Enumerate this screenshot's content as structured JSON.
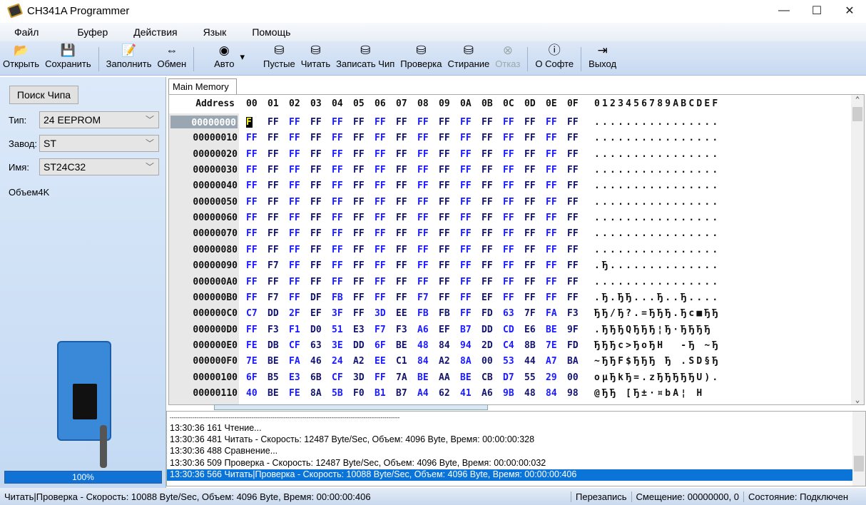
{
  "window": {
    "title": "CH341A Programmer",
    "minimize": "—",
    "maximize": "☐",
    "close": "✕"
  },
  "menu": [
    "Файл",
    "Буфер",
    "Действия",
    "Язык",
    "Помощь"
  ],
  "toolbar": [
    {
      "label": "Открыть",
      "icon": "📂"
    },
    {
      "label": "Сохранить",
      "icon": "💾"
    },
    {
      "sep": true
    },
    {
      "label": "Заполнить",
      "icon": "📝"
    },
    {
      "label": "Обмен",
      "icon": "⇔"
    },
    {
      "sep": true
    },
    {
      "label": "Авто",
      "icon": "◉"
    },
    {
      "label": "▾",
      "icon": ""
    },
    {
      "label": "Пустые",
      "icon": "⛁"
    },
    {
      "label": "Читать",
      "icon": "⛁"
    },
    {
      "label": "Записать Чип",
      "icon": "⛁"
    },
    {
      "label": "Проверка",
      "icon": "⛁"
    },
    {
      "label": "Стирание",
      "icon": "⛁"
    },
    {
      "label": "Отказ",
      "icon": "⊗",
      "disabled": true
    },
    {
      "sep": true
    },
    {
      "label": "О Софте",
      "icon": "ⓘ"
    },
    {
      "sep": true
    },
    {
      "label": "Выход",
      "icon": "⇥"
    }
  ],
  "left": {
    "search_button": "Поиск Чипа",
    "type_label": "Тип:",
    "type_value": "24 EEPROM",
    "maker_label": "Завод:",
    "maker_value": "ST",
    "name_label": "Имя:",
    "name_value": "ST24C32",
    "size": "Объем4K",
    "progress_label": "100%",
    "progress": 100
  },
  "tab": "Main Memory",
  "hex": {
    "address_header": "Address",
    "col_headers": [
      "00",
      "01",
      "02",
      "03",
      "04",
      "05",
      "06",
      "07",
      "08",
      "09",
      "0A",
      "0B",
      "0C",
      "0D",
      "0E",
      "0F"
    ],
    "ascii_header": "0123456789ABCDEF",
    "rows": [
      {
        "addr": "00000000",
        "bytes": "FF FF FF FF FF FF FF FF FF FF FF FF FF FF FF FF",
        "ascii": "................"
      },
      {
        "addr": "00000010",
        "bytes": "FF FF FF FF FF FF FF FF FF FF FF FF FF FF FF FF",
        "ascii": "................"
      },
      {
        "addr": "00000020",
        "bytes": "FF FF FF FF FF FF FF FF FF FF FF FF FF FF FF FF",
        "ascii": "................"
      },
      {
        "addr": "00000030",
        "bytes": "FF FF FF FF FF FF FF FF FF FF FF FF FF FF FF FF",
        "ascii": "................"
      },
      {
        "addr": "00000040",
        "bytes": "FF FF FF FF FF FF FF FF FF FF FF FF FF FF FF FF",
        "ascii": "................"
      },
      {
        "addr": "00000050",
        "bytes": "FF FF FF FF FF FF FF FF FF FF FF FF FF FF FF FF",
        "ascii": "................"
      },
      {
        "addr": "00000060",
        "bytes": "FF FF FF FF FF FF FF FF FF FF FF FF FF FF FF FF",
        "ascii": "................"
      },
      {
        "addr": "00000070",
        "bytes": "FF FF FF FF FF FF FF FF FF FF FF FF FF FF FF FF",
        "ascii": "................"
      },
      {
        "addr": "00000080",
        "bytes": "FF FF FF FF FF FF FF FF FF FF FF FF FF FF FF FF",
        "ascii": "................"
      },
      {
        "addr": "00000090",
        "bytes": "FF F7 FF FF FF FF FF FF FF FF FF FF FF FF FF FF",
        "ascii": ".Ђ.............."
      },
      {
        "addr": "000000A0",
        "bytes": "FF FF FF FF FF FF FF FF FF FF FF FF FF FF FF FF",
        "ascii": "................"
      },
      {
        "addr": "000000B0",
        "bytes": "FF F7 FF DF FB FF FF FF F7 FF FF EF FF FF FF FF",
        "ascii": ".Ђ.ЂЂ...Ђ..Ђ...."
      },
      {
        "addr": "000000C0",
        "bytes": "C7 DD 2F EF 3F FF 3D EE FB FB FF FD 63 7F FA F3",
        "ascii": "ЂЂ/Ђ?.=ЂЂЂ.Ђc■ЂЂ"
      },
      {
        "addr": "000000D0",
        "bytes": "FF F3 F1 D0 51 E3 F7 F3 A6 EF B7 DD CD E6 BE 9F",
        "ascii": ".ЂЂЂQЂЂЂ¦Ђ·ЂЂЂЂ"
      },
      {
        "addr": "000000E0",
        "bytes": "FE DB CF 63 3E DD 6F BE 48 84 94 2D C4 8B 7E FD",
        "ascii": "ЂЂЂc>ЂoЂH  -Ђ ~Ђ"
      },
      {
        "addr": "000000F0",
        "bytes": "7E BE FA 46 24 A2 EE C1 84 A2 8A 00 53 44 A7 BA",
        "ascii": "~ЂЂF$ЂЂЂ Ђ .SD§Ђ"
      },
      {
        "addr": "00000100",
        "bytes": "6F B5 E3 6B CF 3D FF 7A BE AA BE CB D7 55 29 00",
        "ascii": "oµЂkЂ=.zЂЂЂЂЂU)."
      },
      {
        "addr": "00000110",
        "bytes": "40 BE FE 8A 5B F0 B1 B7 A4 62 41 A6 9B 48 84 98",
        "ascii": "@ЂЂ [Ђ±·¤bA¦ H"
      }
    ]
  },
  "log": [
    "-------------------------------------------------------------------------------------------------------------------------",
    "13:30:36 161 Чтение...",
    "13:30:36 481 Читать - Скорость: 12487 Byte/Sec, Объем: 4096 Byte, Время: 00:00:00:328",
    "13:30:36 488 Сравнение...",
    "13:30:36 509 Проверка - Скорость: 12487 Byte/Sec, Объем: 4096 Byte, Время: 00:00:00:032",
    "13:30:36 566 Читать|Проверка - Скорость: 10088 Byte/Sec, Объем: 4096 Byte, Время: 00:00:00:406"
  ],
  "status": {
    "message": "Читать|Проверка - Скорость: 10088 Byte/Sec, Объем: 4096 Byte, Время: 00:00:00:406",
    "mode": "Перезапись",
    "offset": "Смещение: 00000000, 0",
    "state": "Состояние: Подключен"
  }
}
